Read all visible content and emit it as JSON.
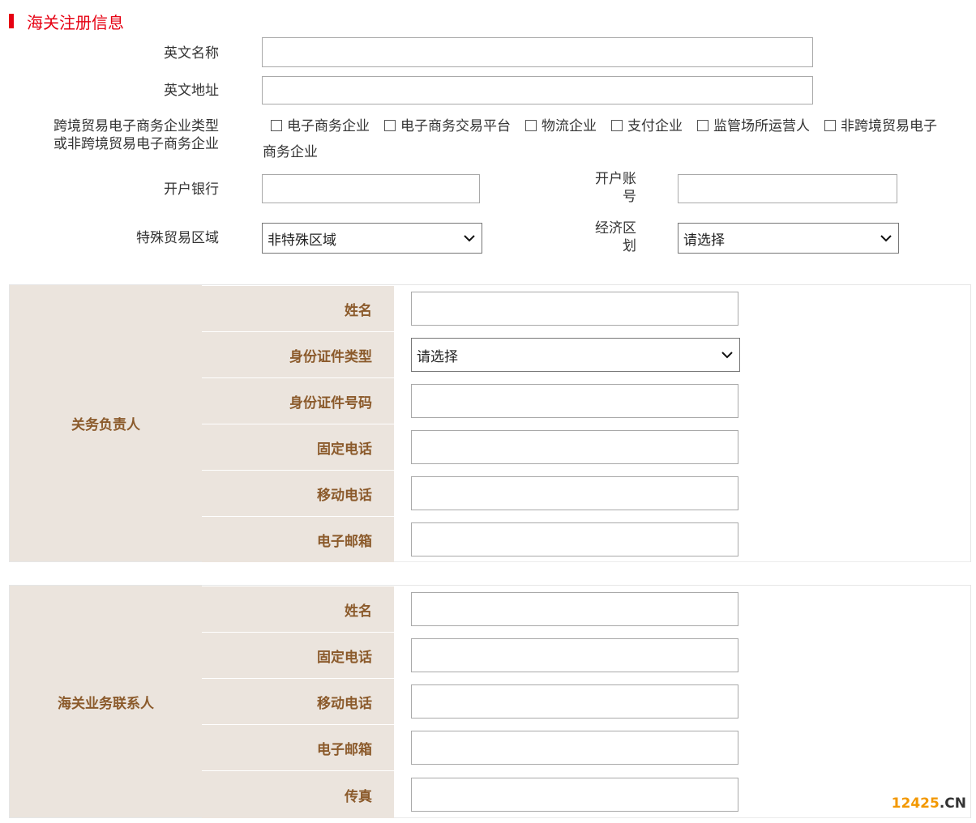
{
  "section": {
    "title": "海关注册信息"
  },
  "form": {
    "english_name": {
      "label": "英文名称",
      "value": ""
    },
    "english_address": {
      "label": "英文地址",
      "value": ""
    },
    "enterprise_type": {
      "label_line1": "跨境贸易电子商务企业类型",
      "label_line2": "或非跨境贸易电子商务企业",
      "options": [
        {
          "label": "电子商务企业",
          "checked": false
        },
        {
          "label": "电子商务交易平台",
          "checked": false
        },
        {
          "label": "物流企业",
          "checked": false
        },
        {
          "label": "支付企业",
          "checked": false
        },
        {
          "label": "监管场所运营人",
          "checked": false
        },
        {
          "label": "非跨境贸易电子商务企业",
          "checked": false
        }
      ]
    },
    "bank": {
      "label": "开户银行",
      "value": ""
    },
    "account": {
      "label_line1": "开户账",
      "label_line2": "号",
      "value": ""
    },
    "special_zone": {
      "label": "特殊贸易区域",
      "selected": "非特殊区域"
    },
    "economic_zone": {
      "label_line1": "经济区",
      "label_line2": "划",
      "selected": "请选择"
    }
  },
  "customs_manager": {
    "group_label": "关务负责人",
    "fields": {
      "name": {
        "label": "姓名",
        "value": ""
      },
      "id_type": {
        "label": "身份证件类型",
        "selected": "请选择"
      },
      "id_number": {
        "label": "身份证件号码",
        "value": ""
      },
      "phone": {
        "label": "固定电话",
        "value": ""
      },
      "mobile": {
        "label": "移动电话",
        "value": ""
      },
      "email": {
        "label": "电子邮箱",
        "value": ""
      }
    }
  },
  "customs_contact": {
    "group_label": "海关业务联系人",
    "fields": {
      "name": {
        "label": "姓名",
        "value": ""
      },
      "phone": {
        "label": "固定电话",
        "value": ""
      },
      "mobile": {
        "label": "移动电话",
        "value": ""
      },
      "email": {
        "label": "电子邮箱",
        "value": ""
      },
      "fax": {
        "label": "传真",
        "value": ""
      }
    }
  },
  "watermark": {
    "number": "12425",
    "suffix": ".CN"
  },
  "colors": {
    "title_red": "#e60012",
    "label_brown": "#8b5a2b",
    "label_bg": "#ebe4dd",
    "watermark_orange": "#f39800"
  }
}
